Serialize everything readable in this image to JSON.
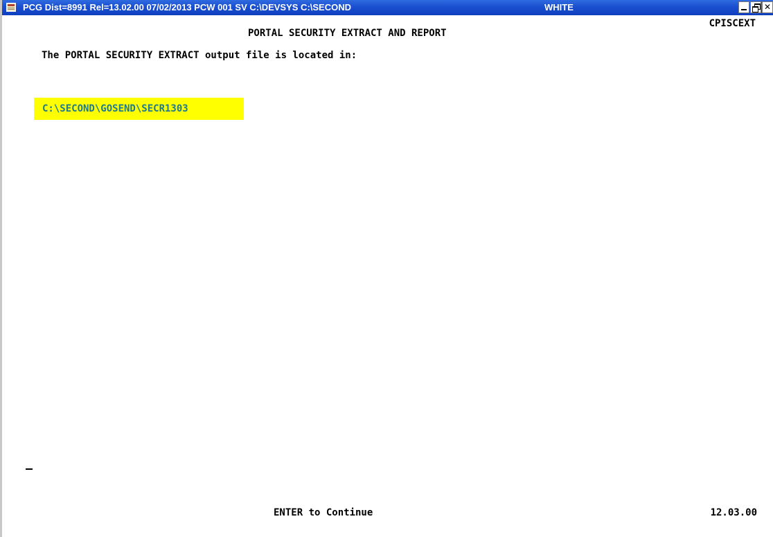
{
  "window": {
    "title": "PCG Dist=8991  Rel=13.02.00  07/02/2013  PCW 001  SV C:\\DEVSYS  C:\\SECOND",
    "title_terminal": "WHITE",
    "buttons": {
      "minimize": "minimize-icon",
      "restore": "restore-icon",
      "close": "close-icon"
    }
  },
  "screen": {
    "screen_id": "CPISCEXT",
    "heading": "PORTAL SECURITY EXTRACT AND REPORT",
    "located_label": "The PORTAL SECURITY EXTRACT output file is located in:",
    "output_path": "C:\\SECOND\\GOSEND\\SECR1303",
    "prompt": "ENTER to Continue",
    "time": "12.03.00"
  },
  "colors": {
    "titlebar": "#1a4fd0",
    "path_highlight": "#ffff00",
    "path_text": "#1f7a8c"
  }
}
